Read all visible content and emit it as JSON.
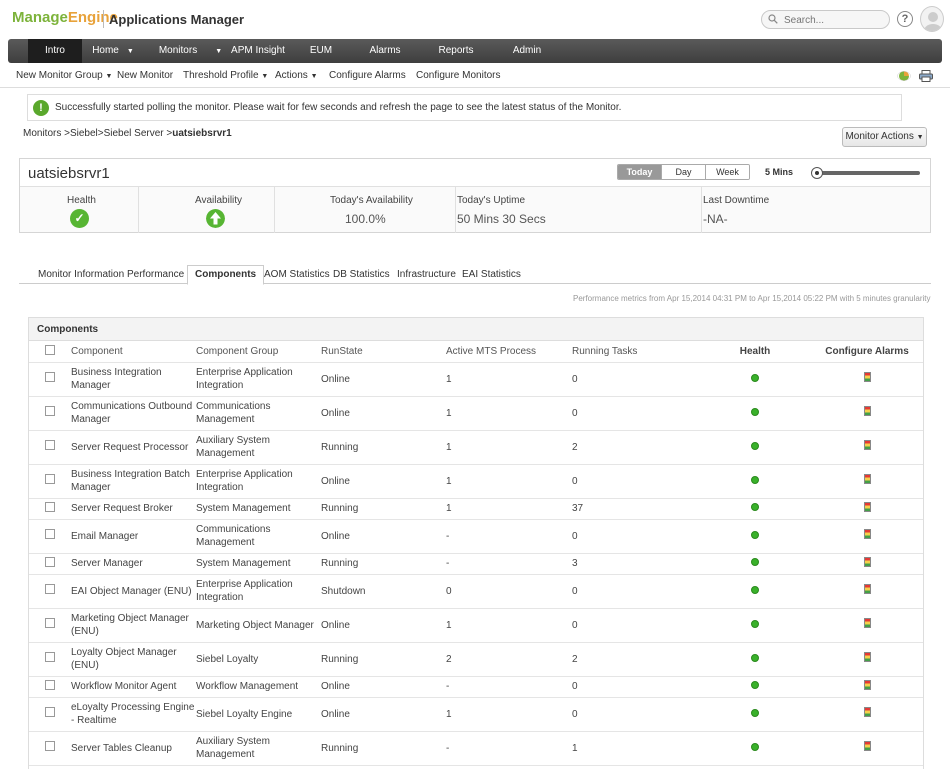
{
  "header": {
    "logo_part1": "Manage",
    "logo_part2": "Engine",
    "app_title": "Applications Manager",
    "search_placeholder": "Search..."
  },
  "main_nav": [
    {
      "label": "Intro",
      "active": true
    },
    {
      "label": "Home"
    },
    {
      "label": "Monitors"
    },
    {
      "label": "APM Insight"
    },
    {
      "label": "EUM"
    },
    {
      "label": "Alarms"
    },
    {
      "label": "Reports"
    },
    {
      "label": "Admin"
    }
  ],
  "sub_nav": [
    {
      "label": "New Monitor Group"
    },
    {
      "label": "New Monitor"
    },
    {
      "label": "Threshold Profile"
    },
    {
      "label": "Actions"
    },
    {
      "label": "Configure Alarms"
    },
    {
      "label": "Configure Monitors"
    }
  ],
  "success_message": "Successfully started polling the monitor. Please wait for few seconds and refresh the page to see the latest status of the Monitor.",
  "breadcrumb": {
    "path": "Monitors >Siebel>Siebel Server >",
    "current": "uatsiebsrvr1"
  },
  "monitor_actions_label": "Monitor Actions",
  "monitor": {
    "name": "uatsiebsrvr1",
    "periods": [
      "Today",
      "Day",
      "Week"
    ],
    "active_period": "Today",
    "interval": "5 Mins",
    "stats": {
      "health_label": "Health",
      "availability_label": "Availability",
      "today_availability_label": "Today's Availability",
      "today_availability_value": "100.0%",
      "uptime_label": "Today's Uptime",
      "uptime_value": "50 Mins 30 Secs",
      "last_downtime_label": "Last Downtime",
      "last_downtime_value": "-NA-"
    }
  },
  "tabs": [
    "Monitor Information",
    "Performance",
    "Components",
    "AOM Statistics",
    "DB Statistics",
    "Infrastructure",
    "EAI Statistics"
  ],
  "active_tab": "Components",
  "perf_note": "Performance metrics from Apr 15,2014 04:31 PM to Apr 15,2014 05:22 PM with 5 minutes granularity",
  "components": {
    "title": "Components",
    "columns": [
      "Component",
      "Component Group",
      "RunState",
      "Active MTS Process",
      "Running Tasks",
      "Health",
      "Configure Alarms"
    ],
    "rows": [
      {
        "component": "Business Integration Manager",
        "group": "Enterprise Application Integration",
        "state": "Online",
        "mts": "1",
        "tasks": "0"
      },
      {
        "component": "Communications Outbound Manager",
        "group": "Communications Management",
        "state": "Online",
        "mts": "1",
        "tasks": "0"
      },
      {
        "component": "Server Request Processor",
        "group": "Auxiliary System Management",
        "state": "Running",
        "mts": "1",
        "tasks": "2"
      },
      {
        "component": "Business Integration Batch Manager",
        "group": "Enterprise Application Integration",
        "state": "Online",
        "mts": "1",
        "tasks": "0"
      },
      {
        "component": "Server Request Broker",
        "group": "System Management",
        "state": "Running",
        "mts": "1",
        "tasks": "37"
      },
      {
        "component": "Email Manager",
        "group": "Communications Management",
        "state": "Online",
        "mts": "-",
        "tasks": "0"
      },
      {
        "component": "Server Manager",
        "group": "System Management",
        "state": "Running",
        "mts": "-",
        "tasks": "3"
      },
      {
        "component": "EAI Object Manager (ENU)",
        "group": "Enterprise Application Integration",
        "state": "Shutdown",
        "mts": "0",
        "tasks": "0"
      },
      {
        "component": "Marketing Object Manager (ENU)",
        "group": "Marketing Object Manager",
        "state": "Online",
        "mts": "1",
        "tasks": "0"
      },
      {
        "component": "Loyalty Object Manager (ENU)",
        "group": "Siebel Loyalty",
        "state": "Running",
        "mts": "2",
        "tasks": "2"
      },
      {
        "component": "Workflow Monitor Agent",
        "group": "Workflow Management",
        "state": "Online",
        "mts": "-",
        "tasks": "0"
      },
      {
        "component": "eLoyalty Processing Engine - Realtime",
        "group": "Siebel Loyalty Engine",
        "state": "Online",
        "mts": "1",
        "tasks": "0"
      },
      {
        "component": "Server Tables Cleanup",
        "group": "Auxiliary System Management",
        "state": "Running",
        "mts": "-",
        "tasks": "1"
      }
    ]
  },
  "colors": {
    "nav_bg": "#4a4a4a",
    "health_green": "#39b12a",
    "logo_green": "#7db33b",
    "logo_orange": "#e8a23a"
  }
}
